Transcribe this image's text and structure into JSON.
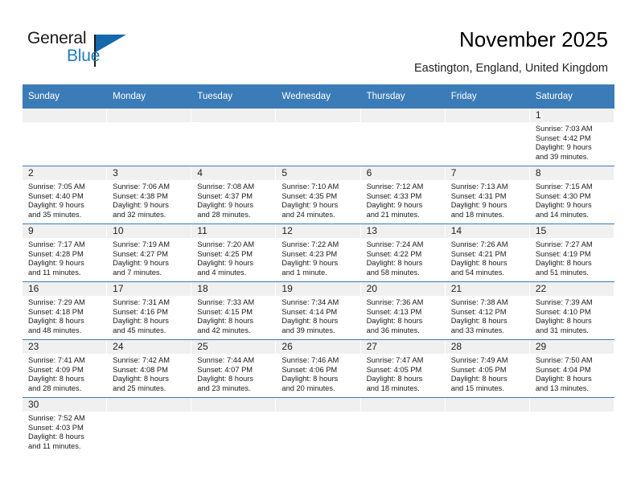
{
  "brand": {
    "name_top": "General",
    "name_bottom": "Blue",
    "accent_color": "#1668ad",
    "logo_icon": "triangle-flag-icon"
  },
  "header": {
    "title": "November 2025",
    "subtitle": "Eastington, England, United Kingdom"
  },
  "calendar": {
    "header_color": "#3b7cb8",
    "daynum_band_color": "#f0f0f0",
    "weekday_headers": [
      "Sunday",
      "Monday",
      "Tuesday",
      "Wednesday",
      "Thursday",
      "Friday",
      "Saturday"
    ],
    "weeks": [
      [
        {
          "day": "",
          "lines": []
        },
        {
          "day": "",
          "lines": []
        },
        {
          "day": "",
          "lines": []
        },
        {
          "day": "",
          "lines": []
        },
        {
          "day": "",
          "lines": []
        },
        {
          "day": "",
          "lines": []
        },
        {
          "day": "1",
          "lines": [
            "Sunrise: 7:03 AM",
            "Sunset: 4:42 PM",
            "Daylight: 9 hours",
            "and 39 minutes."
          ]
        }
      ],
      [
        {
          "day": "2",
          "lines": [
            "Sunrise: 7:05 AM",
            "Sunset: 4:40 PM",
            "Daylight: 9 hours",
            "and 35 minutes."
          ]
        },
        {
          "day": "3",
          "lines": [
            "Sunrise: 7:06 AM",
            "Sunset: 4:38 PM",
            "Daylight: 9 hours",
            "and 32 minutes."
          ]
        },
        {
          "day": "4",
          "lines": [
            "Sunrise: 7:08 AM",
            "Sunset: 4:37 PM",
            "Daylight: 9 hours",
            "and 28 minutes."
          ]
        },
        {
          "day": "5",
          "lines": [
            "Sunrise: 7:10 AM",
            "Sunset: 4:35 PM",
            "Daylight: 9 hours",
            "and 24 minutes."
          ]
        },
        {
          "day": "6",
          "lines": [
            "Sunrise: 7:12 AM",
            "Sunset: 4:33 PM",
            "Daylight: 9 hours",
            "and 21 minutes."
          ]
        },
        {
          "day": "7",
          "lines": [
            "Sunrise: 7:13 AM",
            "Sunset: 4:31 PM",
            "Daylight: 9 hours",
            "and 18 minutes."
          ]
        },
        {
          "day": "8",
          "lines": [
            "Sunrise: 7:15 AM",
            "Sunset: 4:30 PM",
            "Daylight: 9 hours",
            "and 14 minutes."
          ]
        }
      ],
      [
        {
          "day": "9",
          "lines": [
            "Sunrise: 7:17 AM",
            "Sunset: 4:28 PM",
            "Daylight: 9 hours",
            "and 11 minutes."
          ]
        },
        {
          "day": "10",
          "lines": [
            "Sunrise: 7:19 AM",
            "Sunset: 4:27 PM",
            "Daylight: 9 hours",
            "and 7 minutes."
          ]
        },
        {
          "day": "11",
          "lines": [
            "Sunrise: 7:20 AM",
            "Sunset: 4:25 PM",
            "Daylight: 9 hours",
            "and 4 minutes."
          ]
        },
        {
          "day": "12",
          "lines": [
            "Sunrise: 7:22 AM",
            "Sunset: 4:23 PM",
            "Daylight: 9 hours",
            "and 1 minute."
          ]
        },
        {
          "day": "13",
          "lines": [
            "Sunrise: 7:24 AM",
            "Sunset: 4:22 PM",
            "Daylight: 8 hours",
            "and 58 minutes."
          ]
        },
        {
          "day": "14",
          "lines": [
            "Sunrise: 7:26 AM",
            "Sunset: 4:21 PM",
            "Daylight: 8 hours",
            "and 54 minutes."
          ]
        },
        {
          "day": "15",
          "lines": [
            "Sunrise: 7:27 AM",
            "Sunset: 4:19 PM",
            "Daylight: 8 hours",
            "and 51 minutes."
          ]
        }
      ],
      [
        {
          "day": "16",
          "lines": [
            "Sunrise: 7:29 AM",
            "Sunset: 4:18 PM",
            "Daylight: 8 hours",
            "and 48 minutes."
          ]
        },
        {
          "day": "17",
          "lines": [
            "Sunrise: 7:31 AM",
            "Sunset: 4:16 PM",
            "Daylight: 8 hours",
            "and 45 minutes."
          ]
        },
        {
          "day": "18",
          "lines": [
            "Sunrise: 7:33 AM",
            "Sunset: 4:15 PM",
            "Daylight: 8 hours",
            "and 42 minutes."
          ]
        },
        {
          "day": "19",
          "lines": [
            "Sunrise: 7:34 AM",
            "Sunset: 4:14 PM",
            "Daylight: 8 hours",
            "and 39 minutes."
          ]
        },
        {
          "day": "20",
          "lines": [
            "Sunrise: 7:36 AM",
            "Sunset: 4:13 PM",
            "Daylight: 8 hours",
            "and 36 minutes."
          ]
        },
        {
          "day": "21",
          "lines": [
            "Sunrise: 7:38 AM",
            "Sunset: 4:12 PM",
            "Daylight: 8 hours",
            "and 33 minutes."
          ]
        },
        {
          "day": "22",
          "lines": [
            "Sunrise: 7:39 AM",
            "Sunset: 4:10 PM",
            "Daylight: 8 hours",
            "and 31 minutes."
          ]
        }
      ],
      [
        {
          "day": "23",
          "lines": [
            "Sunrise: 7:41 AM",
            "Sunset: 4:09 PM",
            "Daylight: 8 hours",
            "and 28 minutes."
          ]
        },
        {
          "day": "24",
          "lines": [
            "Sunrise: 7:42 AM",
            "Sunset: 4:08 PM",
            "Daylight: 8 hours",
            "and 25 minutes."
          ]
        },
        {
          "day": "25",
          "lines": [
            "Sunrise: 7:44 AM",
            "Sunset: 4:07 PM",
            "Daylight: 8 hours",
            "and 23 minutes."
          ]
        },
        {
          "day": "26",
          "lines": [
            "Sunrise: 7:46 AM",
            "Sunset: 4:06 PM",
            "Daylight: 8 hours",
            "and 20 minutes."
          ]
        },
        {
          "day": "27",
          "lines": [
            "Sunrise: 7:47 AM",
            "Sunset: 4:05 PM",
            "Daylight: 8 hours",
            "and 18 minutes."
          ]
        },
        {
          "day": "28",
          "lines": [
            "Sunrise: 7:49 AM",
            "Sunset: 4:05 PM",
            "Daylight: 8 hours",
            "and 15 minutes."
          ]
        },
        {
          "day": "29",
          "lines": [
            "Sunrise: 7:50 AM",
            "Sunset: 4:04 PM",
            "Daylight: 8 hours",
            "and 13 minutes."
          ]
        }
      ],
      [
        {
          "day": "30",
          "lines": [
            "Sunrise: 7:52 AM",
            "Sunset: 4:03 PM",
            "Daylight: 8 hours",
            "and 11 minutes."
          ]
        },
        {
          "day": "",
          "lines": []
        },
        {
          "day": "",
          "lines": []
        },
        {
          "day": "",
          "lines": []
        },
        {
          "day": "",
          "lines": []
        },
        {
          "day": "",
          "lines": []
        },
        {
          "day": "",
          "lines": []
        }
      ]
    ]
  }
}
